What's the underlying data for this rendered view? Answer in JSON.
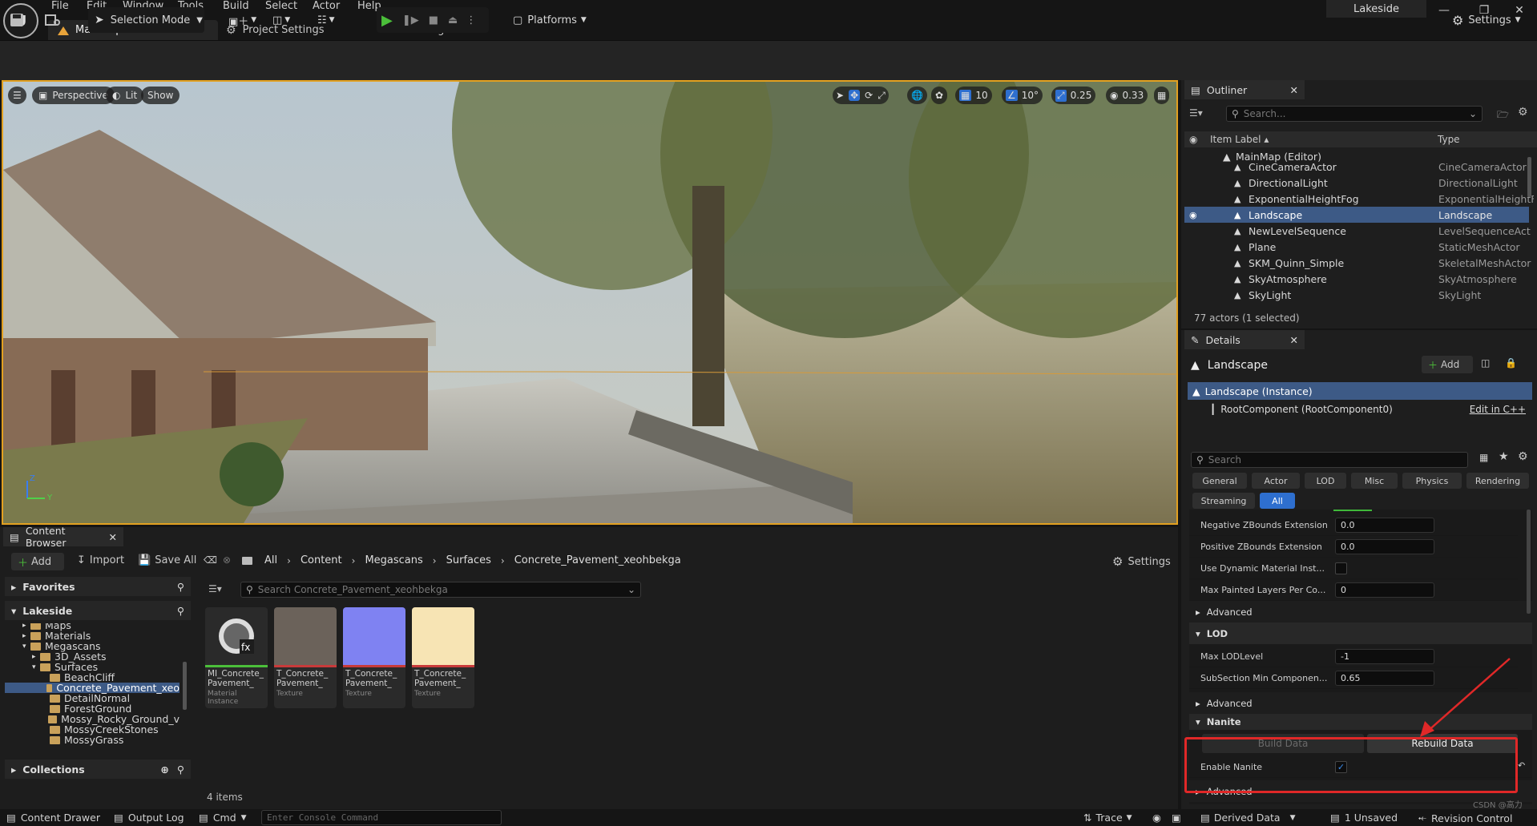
{
  "menu": [
    "File",
    "Edit",
    "Window",
    "Tools",
    "Build",
    "Select",
    "Actor",
    "Help"
  ],
  "project_name": "Lakeside",
  "doc_tab": "MainMap•",
  "tabs": {
    "project_settings": "Project Settings",
    "bridge": "Bridge"
  },
  "toolbar": {
    "selection_mode": "Selection Mode",
    "platforms": "Platforms",
    "settings": "Settings"
  },
  "viewport": {
    "perspective": "Perspective",
    "lit": "Lit",
    "show": "Show",
    "grid": "10",
    "angle": "10°",
    "scale": "0.25",
    "camera_speed": "0.33",
    "axis_z": "Z",
    "axis_y": "Y"
  },
  "outliner": {
    "tab": "Outliner",
    "search_placeholder": "Search...",
    "col_label": "Item Label ▴",
    "col_type": "Type",
    "root": "MainMap (Editor)",
    "rows": [
      {
        "label": "CineCameraActor",
        "type": "CineCameraActor"
      },
      {
        "label": "DirectionalLight",
        "type": "DirectionalLight"
      },
      {
        "label": "ExponentialHeightFog",
        "type": "ExponentialHeightF"
      },
      {
        "label": "Landscape",
        "type": "Landscape",
        "selected": true
      },
      {
        "label": "NewLevelSequence",
        "type": "LevelSequenceAct"
      },
      {
        "label": "Plane",
        "type": "StaticMeshActor"
      },
      {
        "label": "SKM_Quinn_Simple",
        "type": "SkeletalMeshActor"
      },
      {
        "label": "SkyAtmosphere",
        "type": "SkyAtmosphere"
      },
      {
        "label": "SkyLight",
        "type": "SkyLight"
      }
    ],
    "count": "77 actors (1 selected)"
  },
  "details": {
    "tab": "Details",
    "title": "Landscape",
    "add": "Add",
    "instance": "Landscape (Instance)",
    "root_component": "RootComponent (RootComponent0)",
    "edit_cpp": "Edit in C++",
    "search_placeholder": "Search",
    "filters": [
      "General",
      "Actor",
      "LOD",
      "Misc",
      "Physics",
      "Rendering",
      "Streaming",
      "All"
    ],
    "props1": [
      {
        "label": "Negative ZBounds Extension",
        "value": "0.0"
      },
      {
        "label": "Positive ZBounds Extension",
        "value": "0.0"
      },
      {
        "label": "Use Dynamic Material Inst...",
        "value": ""
      },
      {
        "label": "Max Painted Layers Per Co...",
        "value": "0"
      }
    ],
    "advanced": "Advanced",
    "lod_section": "LOD",
    "props2": [
      {
        "label": "Max LODLevel",
        "value": "-1"
      },
      {
        "label": "SubSection Min Componen...",
        "value": "0.65"
      }
    ],
    "nanite_section": "Nanite",
    "build_data": "Build Data",
    "rebuild_data": "Rebuild Data",
    "enable_nanite": "Enable Nanite"
  },
  "content_browser": {
    "tab": "Content Browser",
    "add": "Add",
    "import": "Import",
    "save_all": "Save All",
    "breadcrumbs": [
      "All",
      "Content",
      "Megascans",
      "Surfaces",
      "Concrete_Pavement_xeohbekga"
    ],
    "settings": "Settings",
    "favorites": "Favorites",
    "lakeside": "Lakeside",
    "tree": [
      {
        "label": "Maps",
        "indent": 1
      },
      {
        "label": "Materials",
        "indent": 1
      },
      {
        "label": "Megascans",
        "indent": 1
      },
      {
        "label": "3D_Assets",
        "indent": 2
      },
      {
        "label": "Surfaces",
        "indent": 2
      },
      {
        "label": "BeachCliff",
        "indent": 3
      },
      {
        "label": "Concrete_Pavement_xeo",
        "indent": 3,
        "selected": true
      },
      {
        "label": "DetailNormal",
        "indent": 3
      },
      {
        "label": "ForestGround",
        "indent": 3
      },
      {
        "label": "Mossy_Rocky_Ground_v",
        "indent": 3
      },
      {
        "label": "MossyCreekStones",
        "indent": 3
      },
      {
        "label": "MossyGrass",
        "indent": 3
      }
    ],
    "collections": "Collections",
    "search_placeholder": "Search Concrete_Pavement_xeohbekga",
    "assets": [
      {
        "name": "MI_Concrete_ Pavement_",
        "kind": "Material Instance",
        "color": "#2b2b2b"
      },
      {
        "name": "T_Concrete_ Pavement_",
        "kind": "Texture",
        "color": "#6b625a"
      },
      {
        "name": "T_Concrete_ Pavement_",
        "kind": "Texture",
        "color": "#7f82f2"
      },
      {
        "name": "T_Concrete_ Pavement_",
        "kind": "Texture",
        "color": "#f7e4b4"
      }
    ],
    "items_count": "4 items"
  },
  "status": {
    "content_drawer": "Content Drawer",
    "output_log": "Output Log",
    "cmd": "Cmd",
    "console_placeholder": "Enter Console Command",
    "trace": "Trace",
    "derived_data": "Derived Data",
    "unsaved": "1 Unsaved",
    "revision_control": "Revision Control",
    "watermark": "CSDN @高力"
  }
}
